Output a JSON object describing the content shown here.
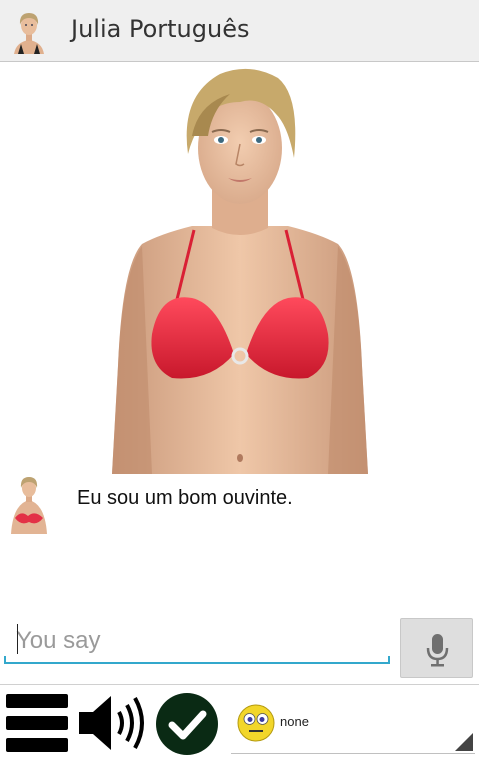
{
  "header": {
    "title": "Julia Português",
    "app_icon": "avatar-face-icon"
  },
  "conversation": {
    "last_reply": "Eu sou um bom ouvinte."
  },
  "input": {
    "placeholder": "You say",
    "value": ""
  },
  "toolbar": {
    "mic_icon": "microphone-icon",
    "menu_icon": "menu-icon",
    "sound_icon": "speaker-icon",
    "confirm_icon": "checkmark-icon"
  },
  "emotion": {
    "selected": "none",
    "icon": "neutral-face-icon"
  },
  "colors": {
    "accent": "#33a8cc",
    "header_bg": "#efefef",
    "swimsuit": "#e8283c",
    "check_bg": "#0a2a14"
  }
}
